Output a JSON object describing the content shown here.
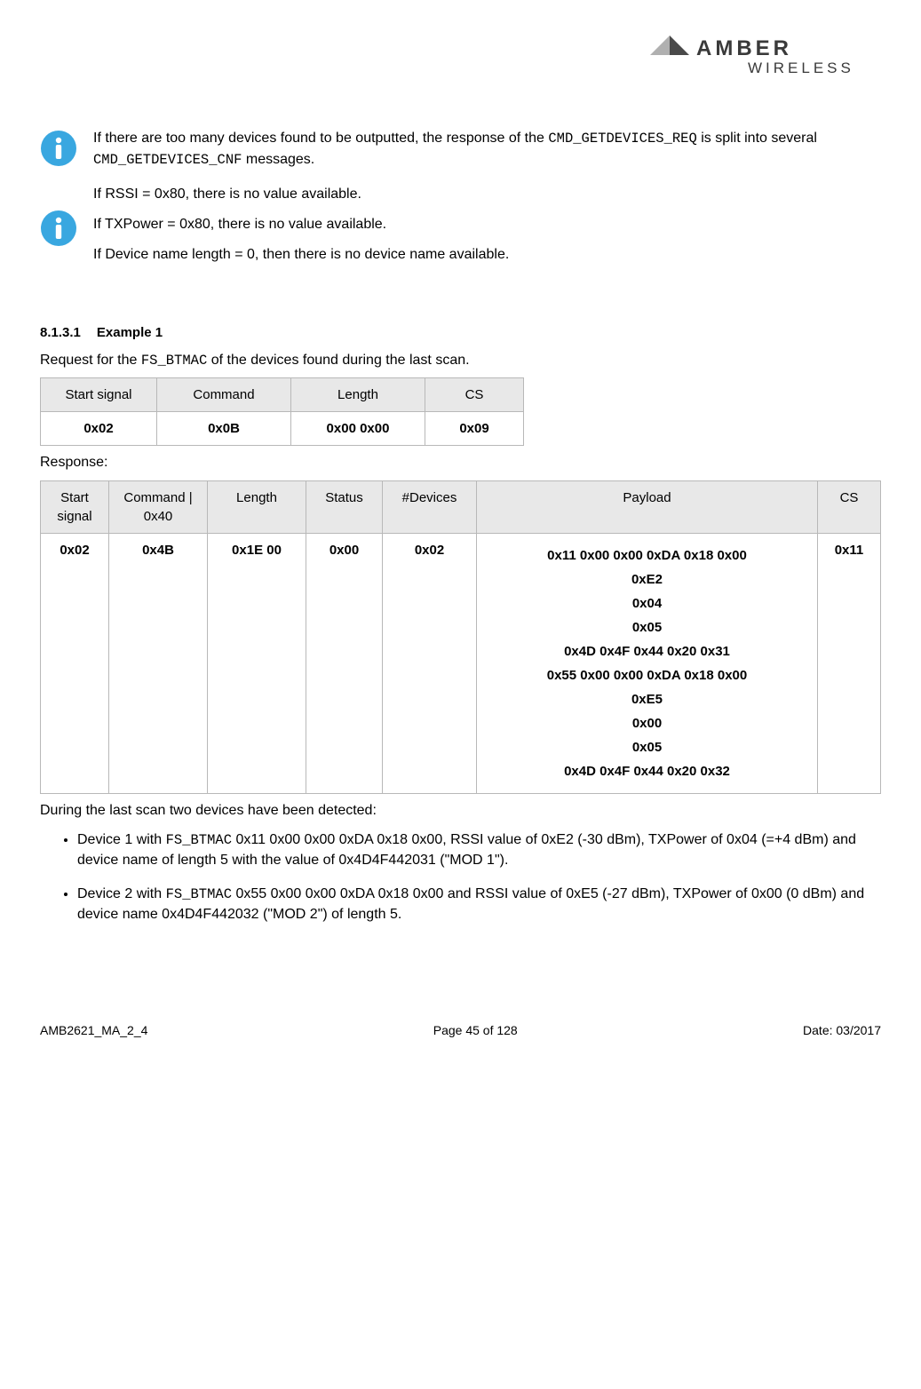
{
  "brand": {
    "name1": "AMBER",
    "name2": "WIRELESS"
  },
  "info1": {
    "pre": "If there are too many devices found to be outputted, the response of the ",
    "code1": "CMD_GETDEVICES_REQ",
    "mid": " is split into several ",
    "code2": "CMD_GETDEVICES_CNF",
    "post": " messages."
  },
  "info2": {
    "l1": "If RSSI = 0x80, there is no value available.",
    "l2": "If TXPower = 0x80, there is no value available.",
    "l3": "If Device name length = 0, then there is no device name available."
  },
  "heading": {
    "num": "8.1.3.1",
    "title": "Example 1"
  },
  "p_request_pre": "Request for the ",
  "p_request_code": "FS_BTMAC",
  "p_request_post": " of the devices found during the last scan.",
  "table1": {
    "headers": [
      "Start signal",
      "Command",
      "Length",
      "CS"
    ],
    "row": [
      "0x02",
      "0x0B",
      "0x00 0x00",
      "0x09"
    ]
  },
  "p_response": "Response:",
  "table2": {
    "headers": [
      "Start signal",
      "Command | 0x40",
      "Length",
      "Status",
      "#Devices",
      "Payload",
      "CS"
    ],
    "row": {
      "start": "0x02",
      "cmd": "0x4B",
      "len": "0x1E 00",
      "status": "0x00",
      "ndev": "0x02",
      "payload": [
        "0x11 0x00 0x00 0xDA 0x18 0x00",
        "0xE2",
        "0x04",
        "0x05",
        "0x4D 0x4F 0x44 0x20 0x31",
        "0x55 0x00 0x00 0xDA 0x18 0x00",
        "0xE5",
        "0x00",
        "0x05",
        "0x4D 0x4F 0x44 0x20 0x32"
      ],
      "cs": "0x11"
    }
  },
  "p_during": "During the last scan two devices have been detected:",
  "bullets": [
    {
      "pre": "Device 1 with ",
      "code": "FS_BTMAC",
      "post": " 0x11 0x00 0x00 0xDA 0x18 0x00, RSSI value of 0xE2 (-30 dBm), TXPower of 0x04 (=+4 dBm) and device name of length 5 with the value of 0x4D4F442031 (\"MOD 1\")."
    },
    {
      "pre": "Device 2 with ",
      "code": "FS_BTMAC",
      "post": " 0x55 0x00 0x00 0xDA 0x18 0x00 and RSSI value of 0xE5 (-27 dBm), TXPower of 0x00 (0 dBm) and device name 0x4D4F442032 (\"MOD 2\") of length 5."
    }
  ],
  "footer": {
    "left": "AMB2621_MA_2_4",
    "center": "Page 45 of 128",
    "right": "Date: 03/2017"
  }
}
